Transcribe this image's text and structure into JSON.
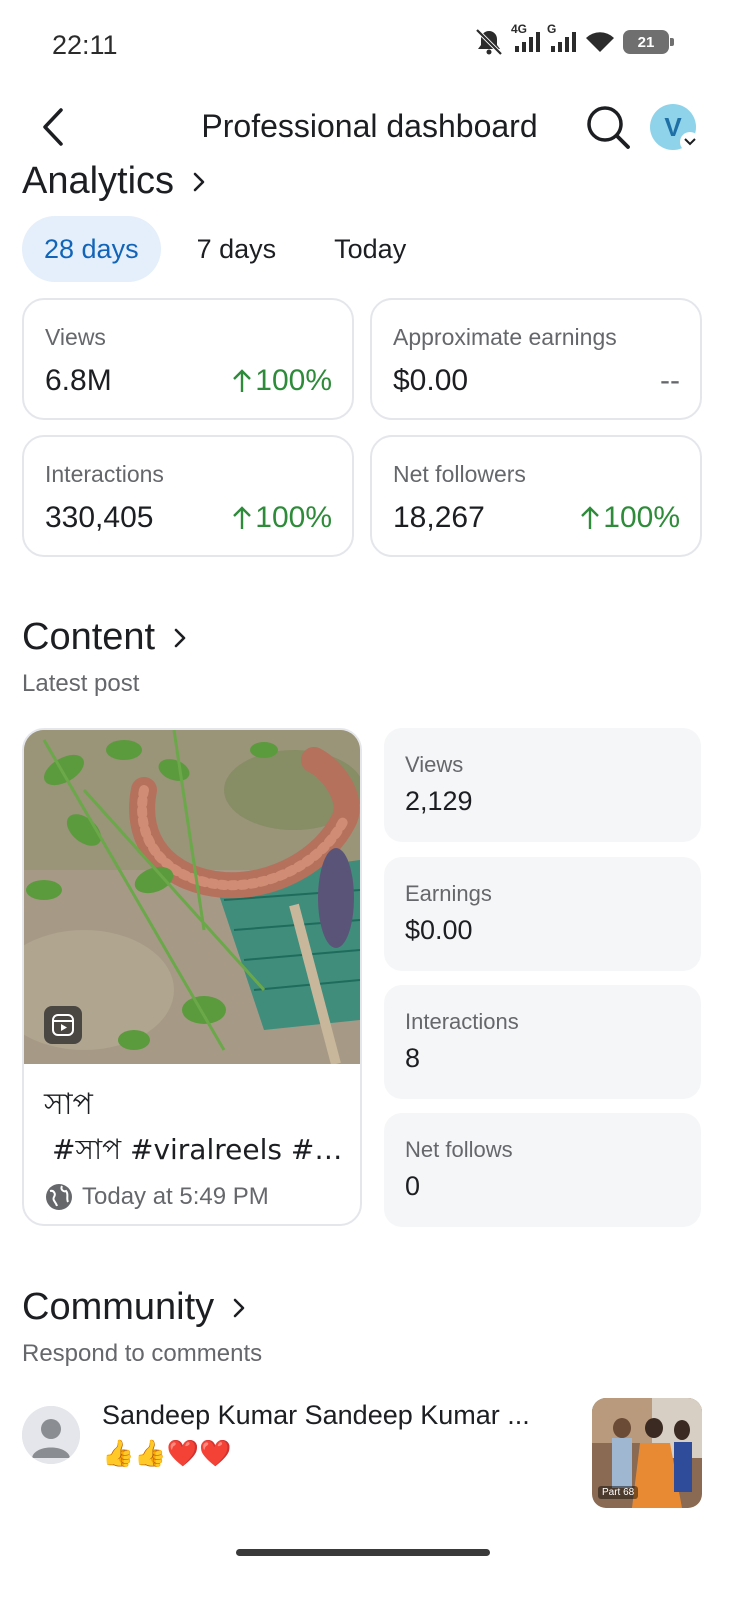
{
  "status_bar": {
    "time": "22:11",
    "network_label_1": "4G",
    "network_label_2": "G",
    "battery_level": "21"
  },
  "nav": {
    "title": "Professional dashboard",
    "avatar_initial": "V"
  },
  "analytics": {
    "title": "Analytics",
    "tabs": [
      {
        "label": "28 days",
        "active": true
      },
      {
        "label": "7 days",
        "active": false
      },
      {
        "label": "Today",
        "active": false
      }
    ],
    "metrics": [
      {
        "label": "Views",
        "value": "6.8M",
        "change": "100%",
        "trend": "up"
      },
      {
        "label": "Approximate earnings",
        "value": "$0.00",
        "change": "--",
        "trend": "none"
      },
      {
        "label": "Interactions",
        "value": "330,405",
        "change": "100%",
        "trend": "up"
      },
      {
        "label": "Net followers",
        "value": "18,267",
        "change": "100%",
        "trend": "up"
      }
    ]
  },
  "content": {
    "title": "Content",
    "subtitle": "Latest post",
    "post": {
      "title": "সাপ",
      "caption": " #সাপ #viralreels #v...",
      "time": "Today at 5:49 PM"
    },
    "stats": [
      {
        "label": "Views",
        "value": "2,129"
      },
      {
        "label": "Earnings",
        "value": "$0.00"
      },
      {
        "label": "Interactions",
        "value": "8"
      },
      {
        "label": "Net follows",
        "value": "0"
      }
    ]
  },
  "community": {
    "title": "Community",
    "subtitle": "Respond to comments",
    "comment": {
      "name": "Sandeep Kumar Sandeep Kumar ...",
      "text": "👍👍❤️❤️",
      "thumb_label": "Part 68"
    }
  },
  "colors": {
    "accent": "#1264b8",
    "active_tab_bg": "#e4effb",
    "positive": "#2e8b3a",
    "card_border": "#e4e6eb",
    "stat_bg": "#f5f6f8"
  }
}
